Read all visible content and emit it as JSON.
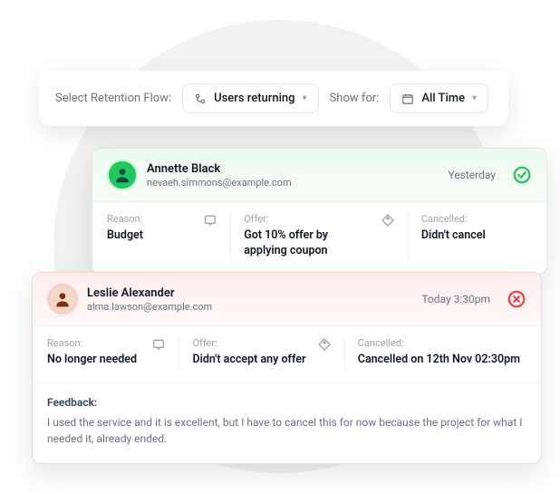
{
  "filters": {
    "select_label": "Select Retention Flow:",
    "flow_value": "Users returning",
    "show_label": "Show for:",
    "time_value": "All Time"
  },
  "cards": [
    {
      "name": "Annette Black",
      "email": "nevaeh.simmons@example.com",
      "timestamp": "Yesterday",
      "reason_label": "Reason:",
      "reason": "Budget",
      "offer_label": "Offer:",
      "offer": "Got 10% offer by applying coupon",
      "cancelled_label": "Cancelled:",
      "cancelled": "Didn't cancel"
    },
    {
      "name": "Leslie Alexander",
      "email": "alma.lawson@example.com",
      "timestamp": "Today 3:30pm",
      "reason_label": "Reason:",
      "reason": "No longer needed",
      "offer_label": "Offer:",
      "offer": "Didn't accept any offer",
      "cancelled_label": "Cancelled:",
      "cancelled": "Cancelled on 12th Nov 02:30pm",
      "feedback_label": "Feedback:",
      "feedback": "I used the service and it is excellent, but I have to cancel this for now because the project for what I needed it, already ended."
    }
  ]
}
